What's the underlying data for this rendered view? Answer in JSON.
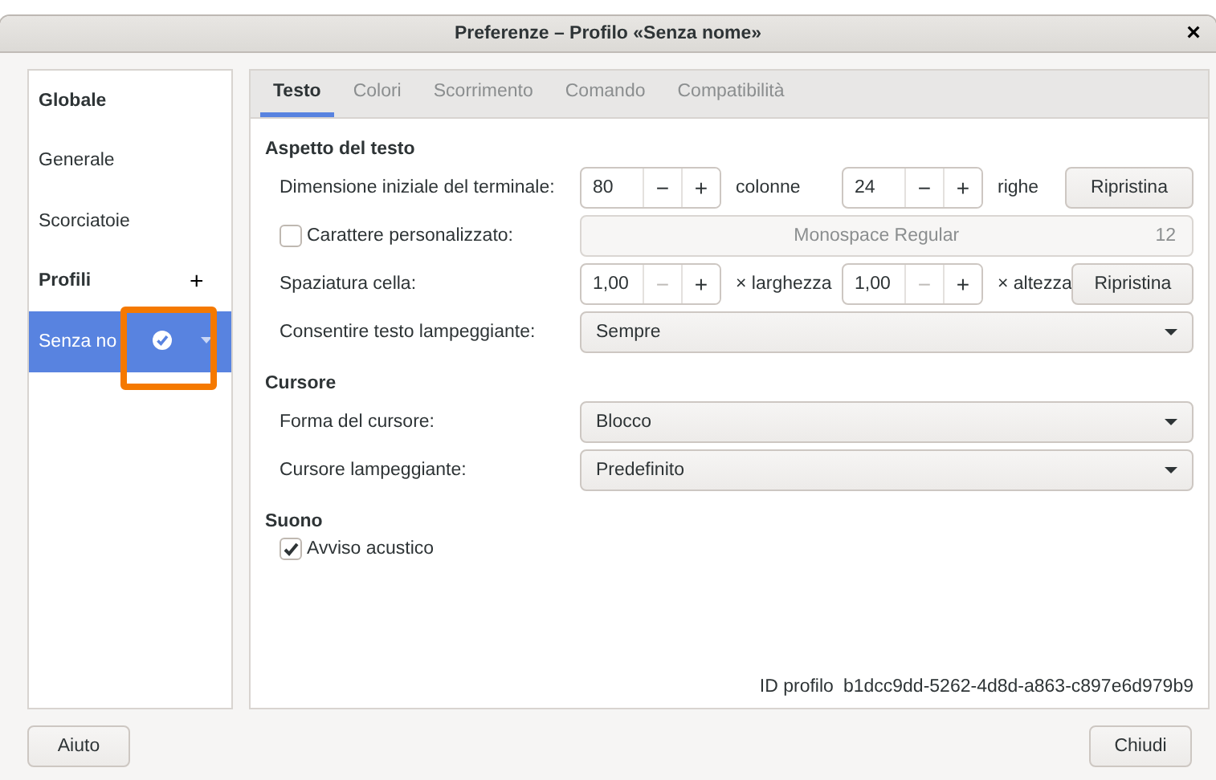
{
  "window": {
    "title": "Preferenze – Profilo «Senza nome»",
    "close": "×"
  },
  "sidebar": {
    "items": [
      {
        "kind": "header",
        "label": "Globale"
      },
      {
        "kind": "item",
        "label": "Generale",
        "selected": false
      },
      {
        "kind": "item",
        "label": "Scorciatoie",
        "selected": false
      },
      {
        "kind": "header",
        "label": "Profili",
        "add": "+"
      },
      {
        "kind": "item",
        "label": "Senza no",
        "selected": true,
        "default": true,
        "highlighted": true
      }
    ]
  },
  "tabs": [
    {
      "label": "Testo",
      "selected": true
    },
    {
      "label": "Colori",
      "selected": false
    },
    {
      "label": "Scorrimento",
      "selected": false
    },
    {
      "label": "Comando",
      "selected": false
    },
    {
      "label": "Compatibilità",
      "selected": false
    }
  ],
  "sections": [
    {
      "title": "Aspetto del testo",
      "rows": [
        {
          "kind": "spins",
          "label": "Dimensione iniziale del terminale:",
          "spins": [
            {
              "value": "80",
              "minus": "−",
              "plus": "+",
              "minus_disabled": false,
              "unit": "colonne"
            },
            {
              "value": "24",
              "minus": "−",
              "plus": "+",
              "minus_disabled": false,
              "unit": "righe"
            }
          ],
          "button": "Ripristina"
        },
        {
          "kind": "font",
          "label": "Carattere personalizzato:",
          "checked": false,
          "font": "Monospace Regular",
          "size": "12",
          "disabled": true
        },
        {
          "kind": "spins",
          "label": "Spaziatura cella:",
          "spins": [
            {
              "value": "1,00",
              "minus": "−",
              "plus": "+",
              "minus_disabled": true,
              "unit": "× larghezza"
            },
            {
              "value": "1,00",
              "minus": "−",
              "plus": "+",
              "minus_disabled": true,
              "unit": "× altezza"
            }
          ],
          "button": "Ripristina"
        },
        {
          "kind": "combo",
          "label": "Consentire testo lampeggiante:",
          "value": "Sempre"
        }
      ]
    },
    {
      "title": "Cursore",
      "rows": [
        {
          "kind": "combo",
          "label": "Forma del cursore:",
          "value": "Blocco"
        },
        {
          "kind": "combo",
          "label": "Cursore lampeggiante:",
          "value": "Predefinito"
        }
      ]
    },
    {
      "title": "Suono",
      "rows": [
        {
          "kind": "check",
          "label": "Avviso acustico",
          "checked": true
        }
      ]
    }
  ],
  "profile_id": {
    "label": "ID profilo",
    "value": "b1dcc9dd-5262-4d8d-a863-c897e6d979b9"
  },
  "buttons": {
    "help": "Aiuto",
    "close": "Chiudi"
  }
}
